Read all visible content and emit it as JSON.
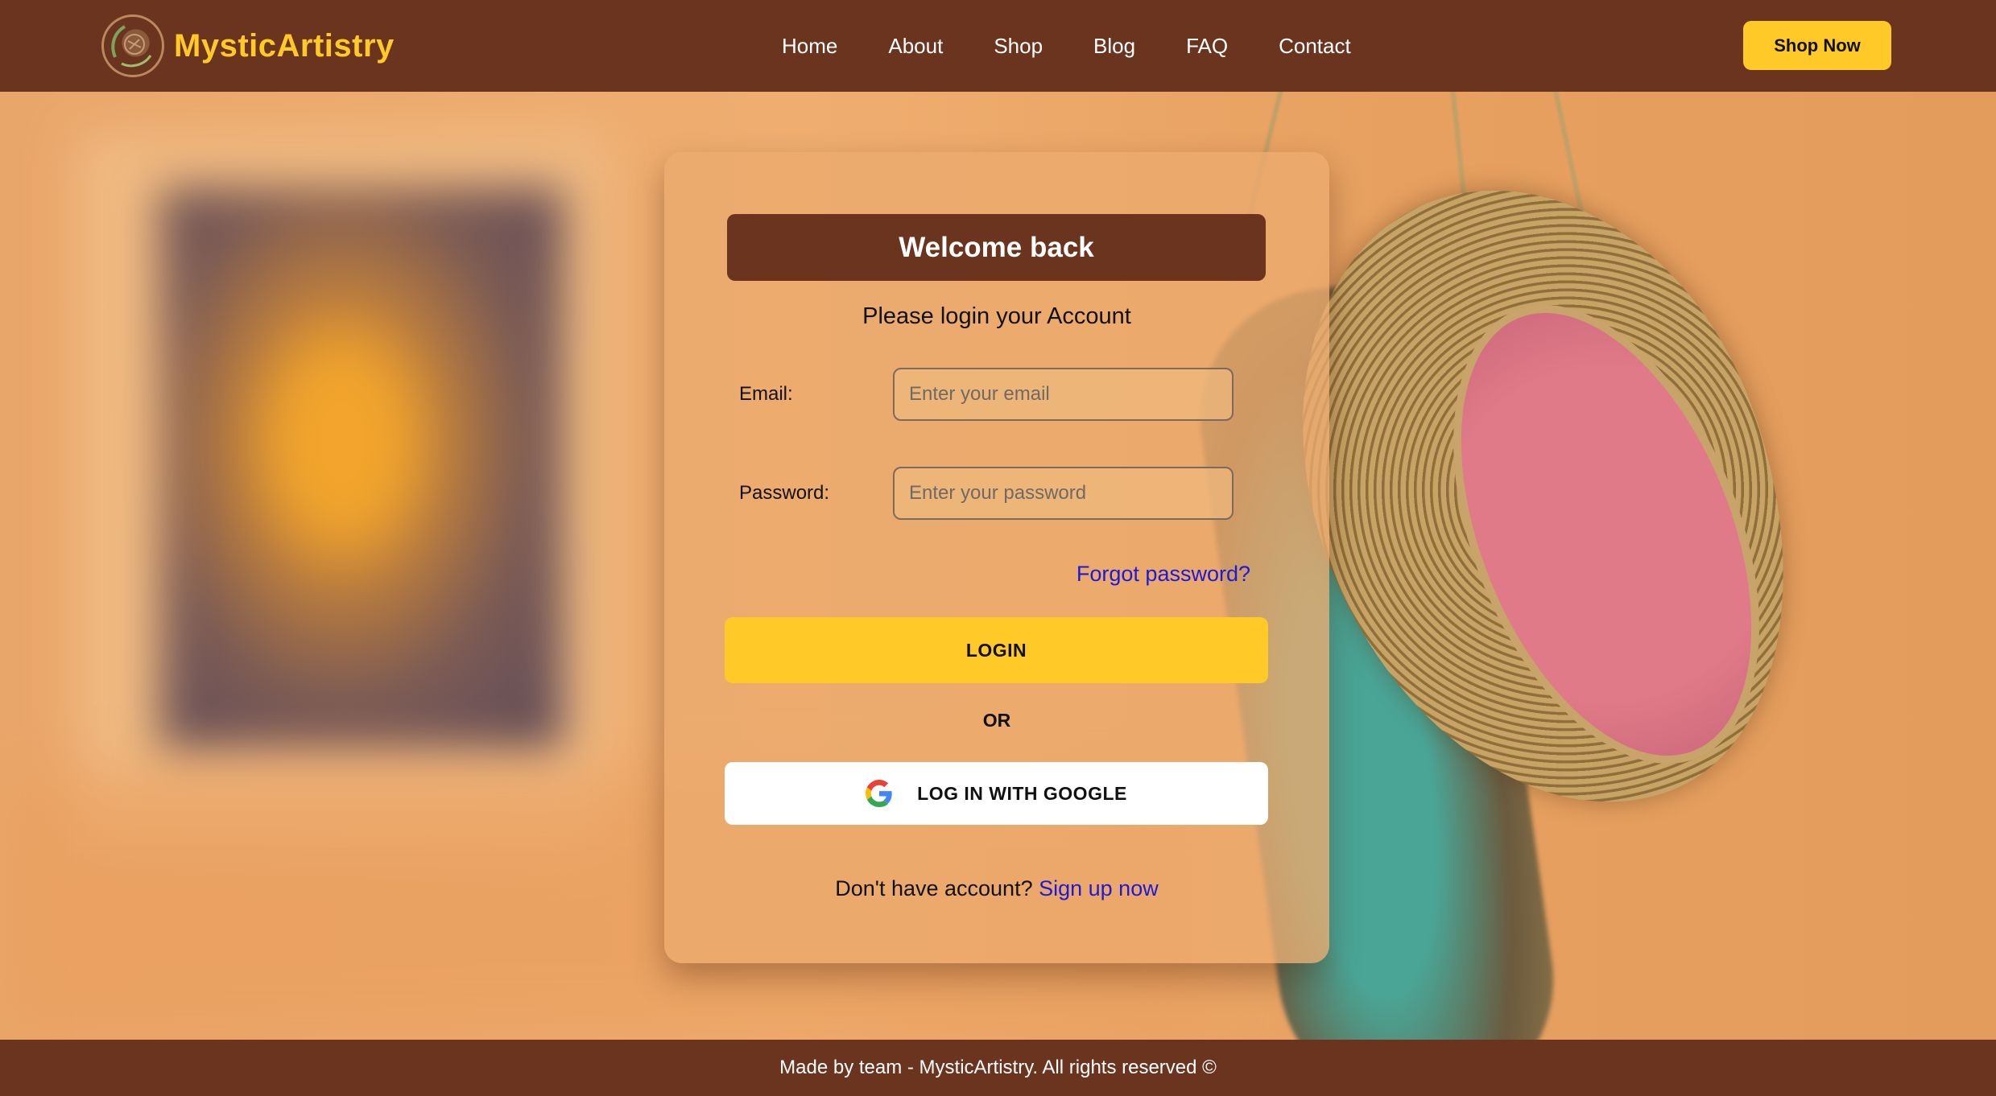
{
  "navbar": {
    "brand": "MysticArtistry",
    "links": [
      "Home",
      "About",
      "Shop",
      "Blog",
      "FAQ",
      "Contact"
    ],
    "cta": "Shop Now"
  },
  "login": {
    "title": "Welcome back",
    "subtitle": "Please login your Account",
    "email_label": "Email:",
    "email_placeholder": "Enter your email",
    "password_label": "Password:",
    "password_placeholder": "Enter your password",
    "forgot": "Forgot password?",
    "login_button": "LOGIN",
    "or": "OR",
    "google_button": "LOG IN WITH GOOGLE",
    "signup_prompt": "Don't have account?",
    "signup_link": "Sign up now"
  },
  "footer": {
    "text": "Made by team - MysticArtistry. All rights reserved ©"
  },
  "colors": {
    "brown": "#6a341f",
    "accent_yellow": "#ffc928",
    "link_blue": "#1d1ad8"
  }
}
